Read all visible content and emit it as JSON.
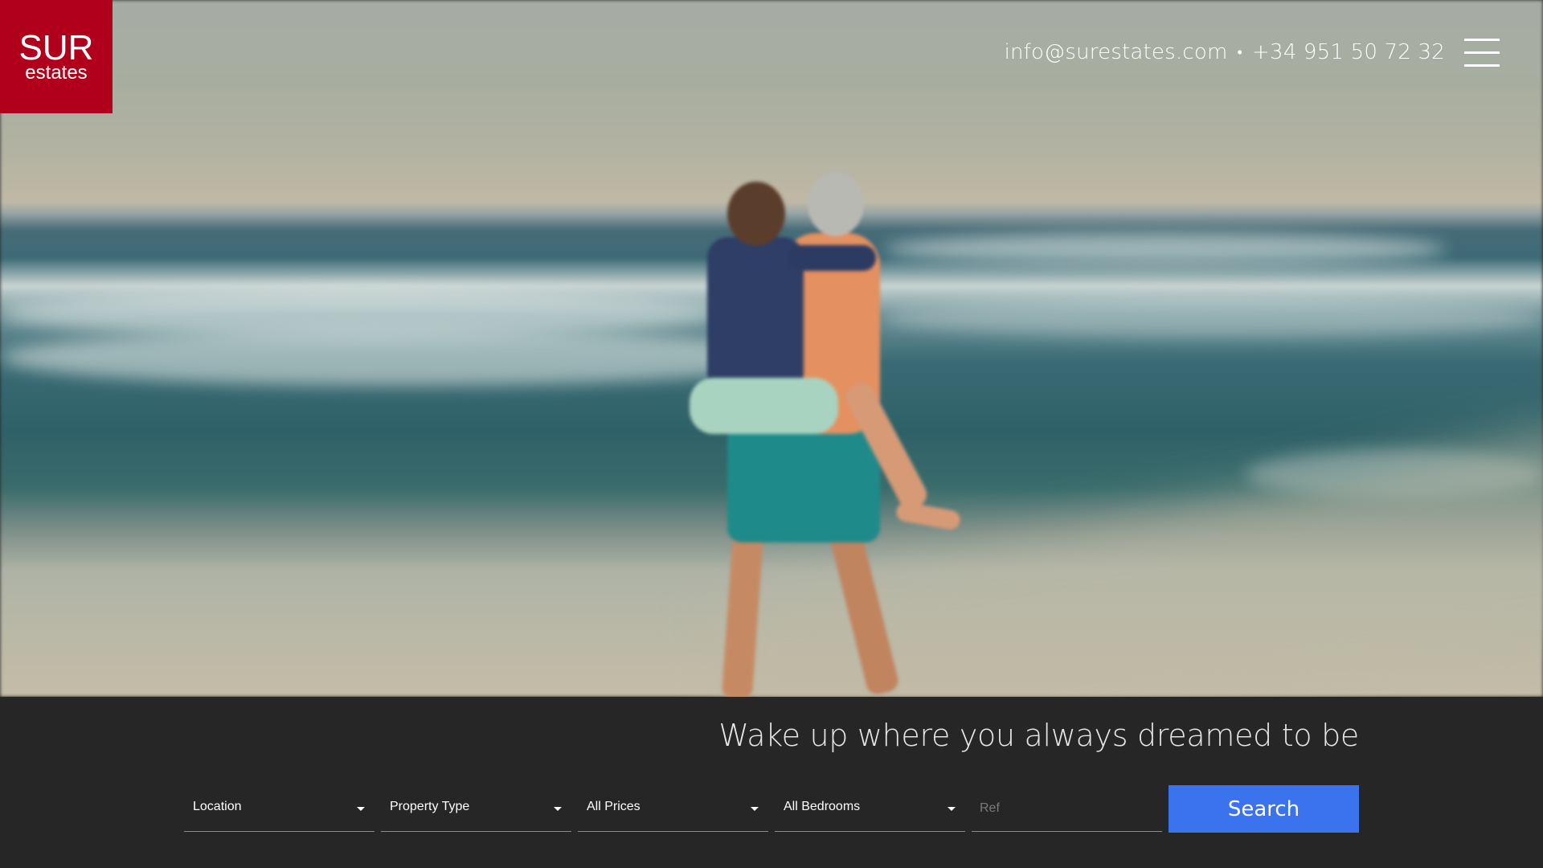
{
  "brand": {
    "logo_line1": "SUR",
    "logo_line2": "estates",
    "color": "#b1001c"
  },
  "header": {
    "email": "info@surestates.com",
    "separator": "•",
    "phone": "+34 951 50 72 32",
    "menu_icon": "hamburger-icon"
  },
  "hero": {
    "tagline": "Wake up where you always dreamed to be"
  },
  "search": {
    "location": "Location",
    "property_type": "Property Type",
    "prices": "All Prices",
    "bedrooms": "All Bedrooms",
    "ref_placeholder": "Ref",
    "button": "Search",
    "button_color": "#3b72ee"
  }
}
